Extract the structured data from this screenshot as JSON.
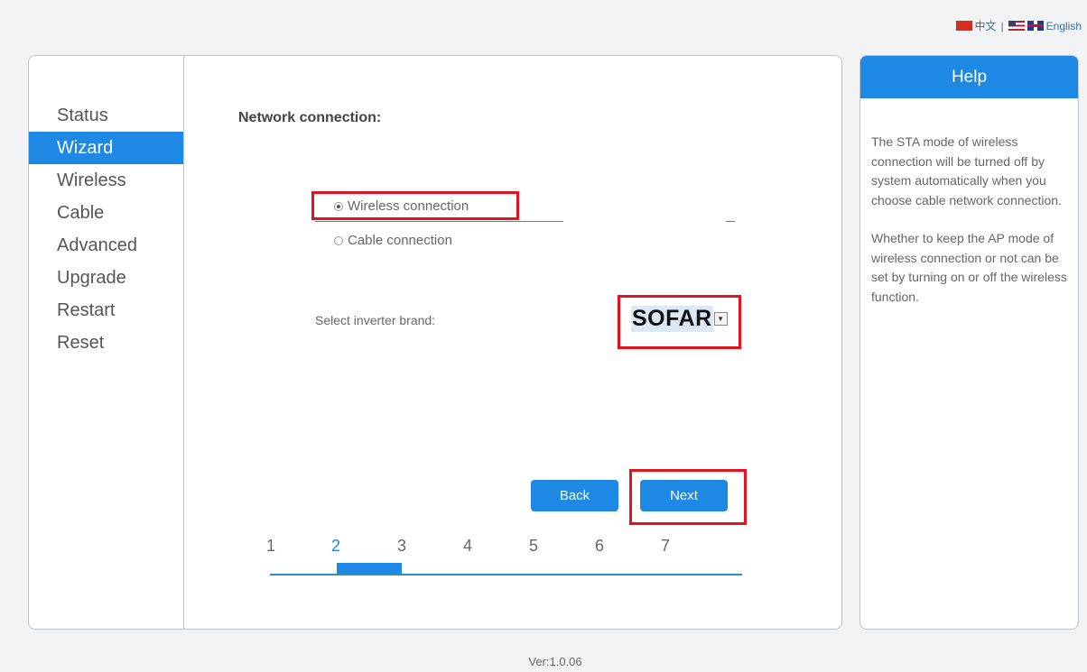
{
  "language_bar": {
    "chinese": "中文",
    "separator": "|",
    "english": "English"
  },
  "sidebar": {
    "items": [
      {
        "label": "Status",
        "active": false
      },
      {
        "label": "Wizard",
        "active": true
      },
      {
        "label": "Wireless",
        "active": false
      },
      {
        "label": "Cable",
        "active": false
      },
      {
        "label": "Advanced",
        "active": false
      },
      {
        "label": "Upgrade",
        "active": false
      },
      {
        "label": "Restart",
        "active": false
      },
      {
        "label": "Reset",
        "active": false
      }
    ]
  },
  "wizard": {
    "title": "Network connection:",
    "options": [
      {
        "label": "Wireless connection",
        "checked": true
      },
      {
        "label": "Cable connection",
        "checked": false
      }
    ],
    "brand_label": "Select inverter brand:",
    "brand_value": "SOFAR",
    "back_label": "Back",
    "next_label": "Next",
    "steps": [
      "1",
      "2",
      "3",
      "4",
      "5",
      "6",
      "7"
    ],
    "current_step": 2
  },
  "help": {
    "title": "Help",
    "paragraphs": [
      "The STA mode of wireless connection will be turned off by system automatically when you choose cable network connection.",
      "Whether to keep the AP mode of wireless connection or not can be set by turning on or off the wireless function."
    ]
  },
  "version": "Ver:1.0.06",
  "colors": {
    "accent": "#1e88e5",
    "highlight": "#e3121c",
    "step_track": "#2a8fc1"
  },
  "icons": [
    "cn-flag-icon",
    "us-flag-icon",
    "uk-flag-icon",
    "dropdown-arrow-icon",
    "radio-icon"
  ]
}
